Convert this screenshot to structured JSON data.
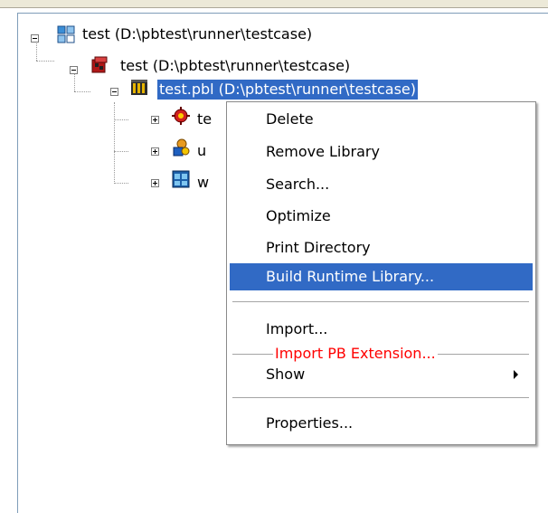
{
  "tree": {
    "nodes": [
      {
        "label": "test (D:\\pbtest\\runner\\testcase)",
        "icon": "workspace-icon"
      },
      {
        "label": "test (D:\\pbtest\\runner\\testcase)",
        "icon": "target-icon"
      },
      {
        "label": "test.pbl (D:\\pbtest\\runner\\testcase)",
        "icon": "library-icon",
        "selected": true
      },
      {
        "label": "te",
        "icon": "application-object-icon"
      },
      {
        "label": "u",
        "icon": "user-object-icon"
      },
      {
        "label": "w",
        "icon": "window-object-icon"
      }
    ]
  },
  "context_menu": {
    "items": [
      {
        "label": "Delete"
      },
      {
        "label": "Remove Library"
      },
      {
        "label": "Search..."
      },
      {
        "label": "Optimize"
      },
      {
        "label": "Print Directory"
      },
      {
        "label": "Build Runtime Library...",
        "highlighted": true
      },
      {
        "label": "Import..."
      },
      {
        "label": "Show",
        "submenu": true
      },
      {
        "label": "Properties..."
      }
    ],
    "overlay_label": "Import PB Extension...",
    "overlay_color": "#ff0000"
  },
  "colors": {
    "selection": "#316ac5",
    "tree_border": "#7f9db9"
  }
}
